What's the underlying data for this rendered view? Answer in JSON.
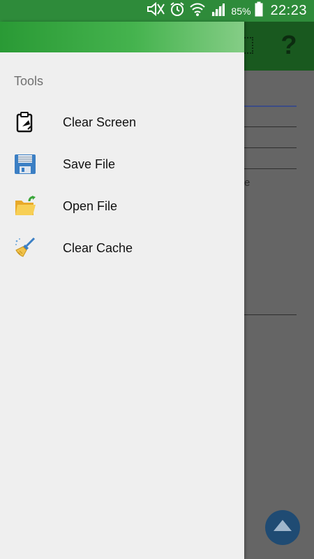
{
  "status_bar": {
    "battery_percent": "85%",
    "time": "22:23",
    "icons": [
      "mute-icon",
      "alarm-icon",
      "wifi-icon",
      "signal-icon",
      "battery-icon"
    ]
  },
  "drawer": {
    "section_title": "Tools",
    "items": [
      {
        "label": "Clear Screen",
        "icon": "clipboard-clear-icon"
      },
      {
        "label": "Save File",
        "icon": "floppy-save-icon"
      },
      {
        "label": "Open File",
        "icon": "folder-open-icon"
      },
      {
        "label": "Clear Cache",
        "icon": "broom-icon"
      }
    ]
  },
  "background_app": {
    "help_glyph": "?",
    "partial_text": "e"
  },
  "colors": {
    "status_bar": "#2e8b3a",
    "drawer_header_start": "#2a9a35",
    "drawer_header_end": "#85cd86",
    "drawer_bg": "#efefef",
    "fab": "#1f4b73"
  }
}
